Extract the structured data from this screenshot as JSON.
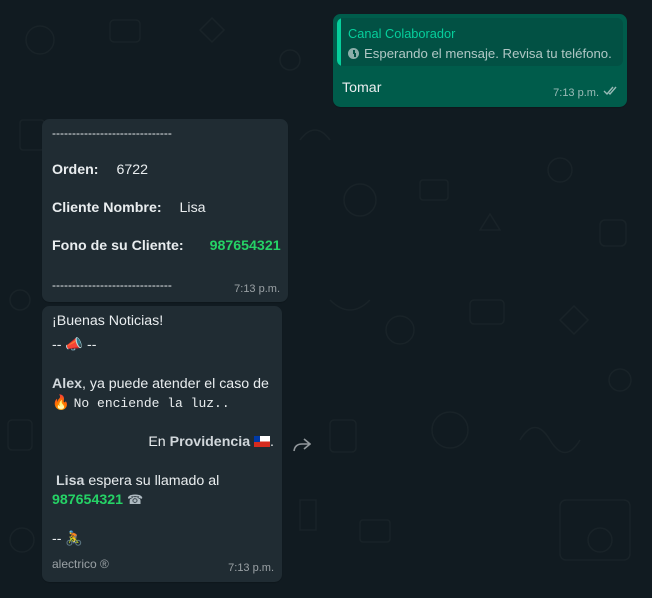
{
  "outgoing": {
    "quote_author": "Canal Colaborador",
    "quote_icon": "clock-icon",
    "quote_text": "Esperando el mensaje. Revisa tu teléfono.",
    "text": "Tomar",
    "time": "7:13 p.m.",
    "status_icon": "double-check-icon"
  },
  "order": {
    "divider_top": "------------------------------",
    "order_label": "Orden:",
    "order_value": "6722",
    "client_label": "Cliente Nombre:",
    "client_value": "Lisa",
    "phone_label": "Fono de su Cliente:",
    "phone_value": "987654321",
    "divider_bottom": "------------------------------",
    "time": "7:13 p.m."
  },
  "news": {
    "greeting": "¡Buenas Noticias!",
    "announce_prefix": "--",
    "announce_icon": "megaphone-icon",
    "announce_suffix": "--",
    "agent_name": "Alex",
    "agent_text": ", ya puede atender el caso de",
    "issue_icon": "fire-icon",
    "issue_text": "No enciende la luz..",
    "location_prefix": "En",
    "location_name": "Providencia",
    "location_flag": "chile-flag-icon",
    "location_suffix": ".",
    "client_name": "Lisa",
    "call_text": "espera su llamado al",
    "phone": "987654321",
    "phone_icon": "phone-icon",
    "footer_prefix": "--",
    "footer_icon": "cyclist-icon",
    "signature": "alectrico ®",
    "time": "7:13 p.m.",
    "forward_icon": "forward-icon"
  }
}
